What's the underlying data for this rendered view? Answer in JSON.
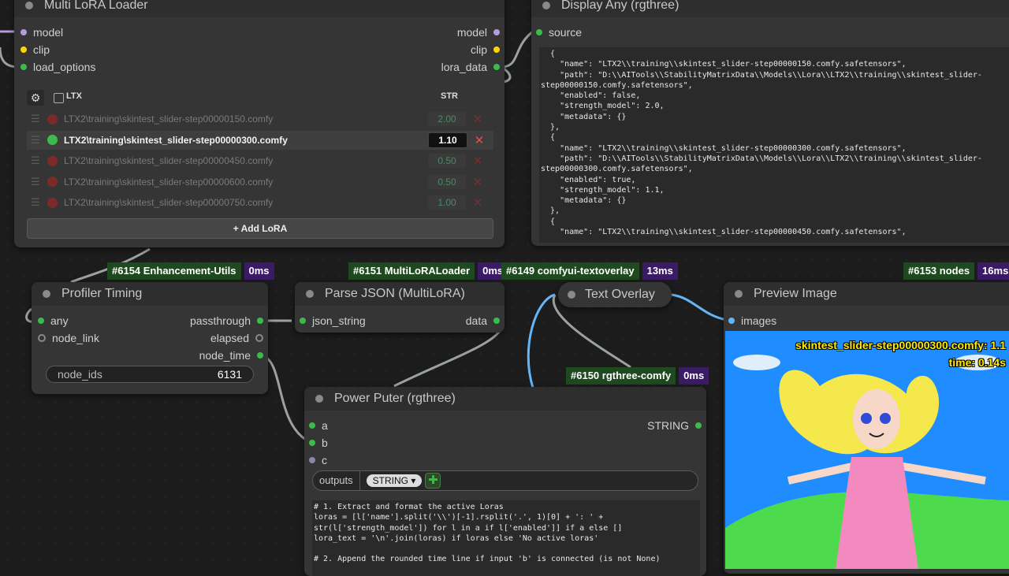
{
  "multi_lora_loader": {
    "title": "Multi LoRA Loader",
    "inputs": [
      "model",
      "clip",
      "load_options"
    ],
    "outputs": [
      "model",
      "clip",
      "lora_data"
    ],
    "filter_label": "LTX",
    "str_header": "STR",
    "rows": [
      {
        "name": "LTX2\\training\\skintest_slider-step00000150.comfy",
        "strength": "2.00",
        "enabled": false
      },
      {
        "name": "LTX2\\training\\skintest_slider-step00000300.comfy",
        "strength": "1.10",
        "enabled": true
      },
      {
        "name": "LTX2\\training\\skintest_slider-step00000450.comfy",
        "strength": "0.50",
        "enabled": false
      },
      {
        "name": "LTX2\\training\\skintest_slider-step00000600.comfy",
        "strength": "0.50",
        "enabled": false
      },
      {
        "name": "LTX2\\training\\skintest_slider-step00000750.comfy",
        "strength": "1.00",
        "enabled": false
      }
    ],
    "add_label": "+ Add LoRA"
  },
  "display_any": {
    "title": "Display Any (rgthree)",
    "input": "source",
    "text": "  {\n    \"name\": \"LTX2\\\\training\\\\skintest_slider-step00000150.comfy.safetensors\",\n    \"path\": \"D:\\\\AITools\\\\StabilityMatrixData\\\\Models\\\\Lora\\\\LTX2\\\\training\\\\skintest_slider-\nstep00000150.comfy.safetensors\",\n    \"enabled\": false,\n    \"strength_model\": 2.0,\n    \"metadata\": {}\n  },\n  {\n    \"name\": \"LTX2\\\\training\\\\skintest_slider-step00000300.comfy.safetensors\",\n    \"path\": \"D:\\\\AITools\\\\StabilityMatrixData\\\\Models\\\\Lora\\\\LTX2\\\\training\\\\skintest_slider-\nstep00000300.comfy.safetensors\",\n    \"enabled\": true,\n    \"strength_model\": 1.1,\n    \"metadata\": {}\n  },\n  {\n    \"name\": \"LTX2\\\\training\\\\skintest_slider-step00000450.comfy.safetensors\","
  },
  "badges": [
    {
      "name": "#6154 Enhancement-Utils",
      "time": "0ms"
    },
    {
      "name": "#6151 MultiLoRALoader",
      "time": "0ms"
    },
    {
      "name": "#6149 comfyui-textoverlay",
      "time": "13ms"
    },
    {
      "name": "#6153 nodes",
      "time": "16ms"
    },
    {
      "name": "#6150 rgthree-comfy",
      "time": "0ms"
    }
  ],
  "profiler": {
    "title": "Profiler Timing",
    "inputs": [
      "any",
      "node_link"
    ],
    "outputs": [
      "passthrough",
      "elapsed",
      "node_time"
    ],
    "widget_label": "node_ids",
    "widget_value": "6131"
  },
  "parse_json": {
    "title": "Parse JSON (MultiLoRA)",
    "input": "json_string",
    "output": "data"
  },
  "text_overlay": {
    "title": "Text Overlay"
  },
  "preview": {
    "title": "Preview Image",
    "input": "images",
    "overlay_line1": "skintest_slider-step00000300.comfy: 1.1",
    "overlay_line2": "time: 0.14s"
  },
  "power_puter": {
    "title": "Power Puter (rgthree)",
    "inputs": [
      "a",
      "b",
      "c"
    ],
    "output": "STRING",
    "outputs_label": "outputs",
    "type_label": "STRING ▾",
    "code": "# 1. Extract and format the active Loras\nloras = [l['name'].split('\\\\')[-1].rsplit('.', 1)[0] + ': ' +\nstr(l['strength_model']) for l in a if l['enabled']] if a else []\nlora_text = '\\n'.join(loras) if loras else 'No active loras'\n\n# 2. Append the rounded time line if input 'b' is connected (is not None)"
  },
  "colors": {
    "model": "#b39ddb",
    "clip": "#ffd500",
    "green": "#3cbb4a",
    "wire_blue": "#64b5f6",
    "wire_grey": "#9aa39a"
  }
}
